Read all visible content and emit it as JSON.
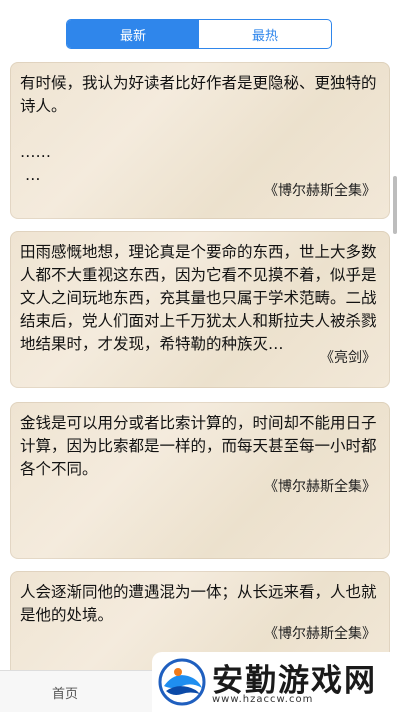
{
  "segmented": {
    "tabs": [
      {
        "label": "最新",
        "active": true
      },
      {
        "label": "最热",
        "active": false
      }
    ]
  },
  "cards": [
    {
      "quote": "有时候，我认为好读者比好作者是更隐秘、更独特的诗人。\n\n……\n …",
      "source": "《博尔赫斯全集》"
    },
    {
      "quote": "田雨感慨地想，理论真是个要命的东西，世上大多数人都不大重视这东西，因为它看不见摸不着，似乎是文人之间玩地东西，充其量也只属于学术范畴。二战结束后，党人们面对上千万犹太人和斯拉夫人被杀戮地结果时，才发现，希特勒的种族灭…",
      "source": "《亮剑》"
    },
    {
      "quote": "金钱是可以用分或者比索计算的，时间却不能用日子计算，因为比索都是一样的，而每天甚至每一小时都各个不同。",
      "source": "《博尔赫斯全集》"
    },
    {
      "quote": "人会逐渐同他的遭遇混为一体；从长远来看，人也就是他的处境。",
      "source": "《博尔赫斯全集》"
    }
  ],
  "tabbar": {
    "home_label": "首页"
  },
  "watermark": {
    "title": "安勤游戏网",
    "url": "www.hzaccw.com"
  },
  "colors": {
    "accent": "#2f86eb",
    "card_bg": "#efe4d2"
  }
}
